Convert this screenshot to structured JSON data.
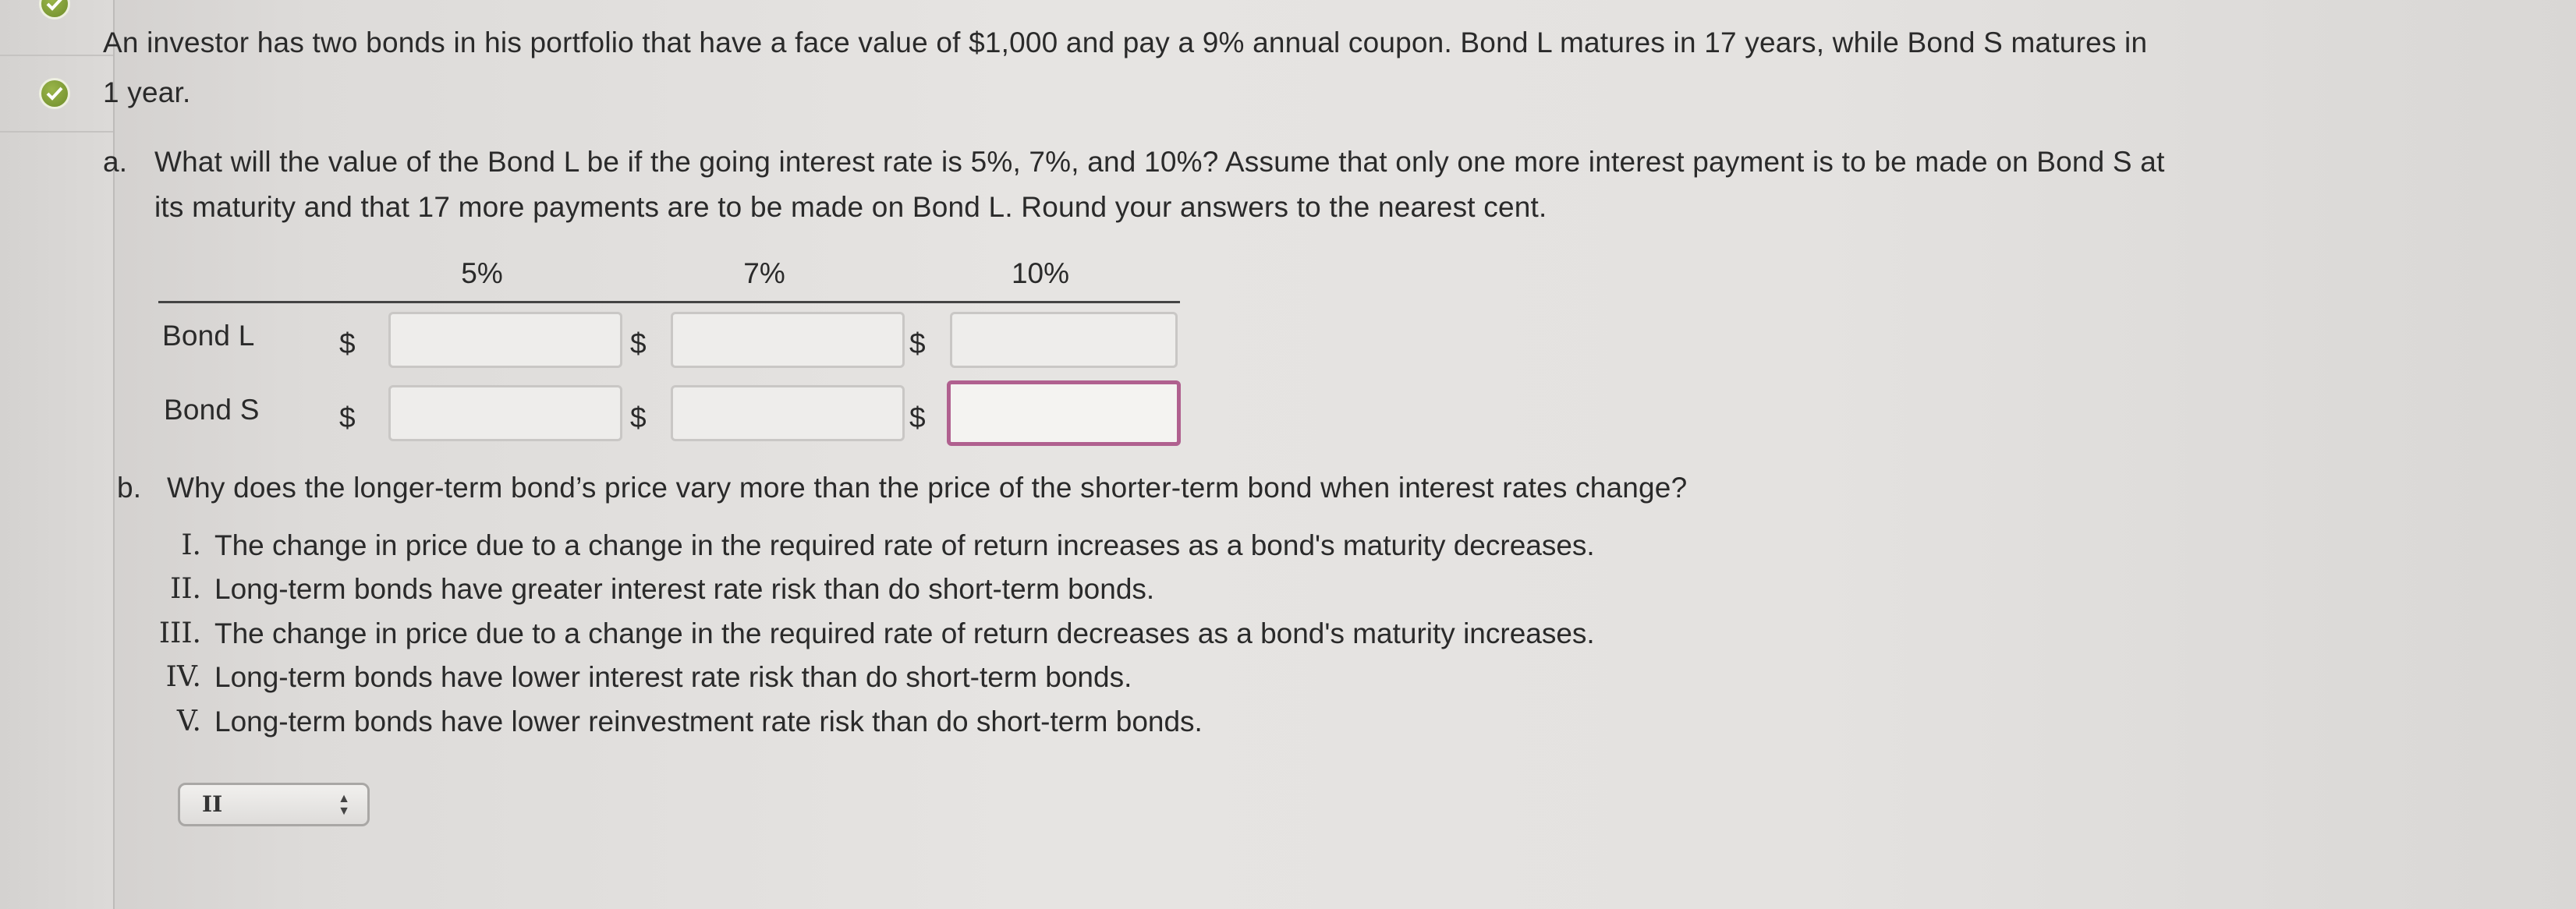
{
  "question": {
    "line1": "An investor has two bonds in his portfolio that have a face value of $1,000 and pay a 9% annual coupon. Bond L matures in 17 years, while Bond S matures in",
    "line2": "1 year."
  },
  "part_a": {
    "marker": "a.",
    "line1": "What will the value of the Bond L be if the going interest rate is 5%, 7%, and 10%? Assume that only one more interest payment is to be made on Bond S at",
    "line2": "its maturity and that 17 more payments are to be made on Bond L. Round your answers to the nearest cent.",
    "columns": [
      "5%",
      "7%",
      "10%"
    ],
    "rows": [
      {
        "label": "Bond L",
        "currency": "$",
        "values": [
          "",
          "",
          ""
        ]
      },
      {
        "label": "Bond S",
        "currency": "$",
        "values": [
          "",
          "",
          ""
        ]
      }
    ]
  },
  "part_b": {
    "marker": "b.",
    "question": "Why does the longer-term bond’s price vary more than the price of the shorter-term bond when interest rates change?",
    "options": [
      {
        "num": "I.",
        "text": "The change in price due to a change in the required rate of return increases as a bond's maturity decreases."
      },
      {
        "num": "II.",
        "text": "Long-term bonds have greater interest rate risk than do short-term bonds."
      },
      {
        "num": "III.",
        "text": "The change in price due to a change in the required rate of return decreases as a bond's maturity increases."
      },
      {
        "num": "IV.",
        "text": "Long-term bonds have lower interest rate risk than do short-term bonds."
      },
      {
        "num": "V.",
        "text": "Long-term bonds have lower reinvestment rate risk than do short-term bonds."
      }
    ],
    "selected": "II"
  },
  "icons": [
    "check-circle-icon",
    "check-circle-icon",
    "select-arrows-icon"
  ],
  "colors": {
    "check": "#7a9a30",
    "active_border": "#b0608f"
  }
}
